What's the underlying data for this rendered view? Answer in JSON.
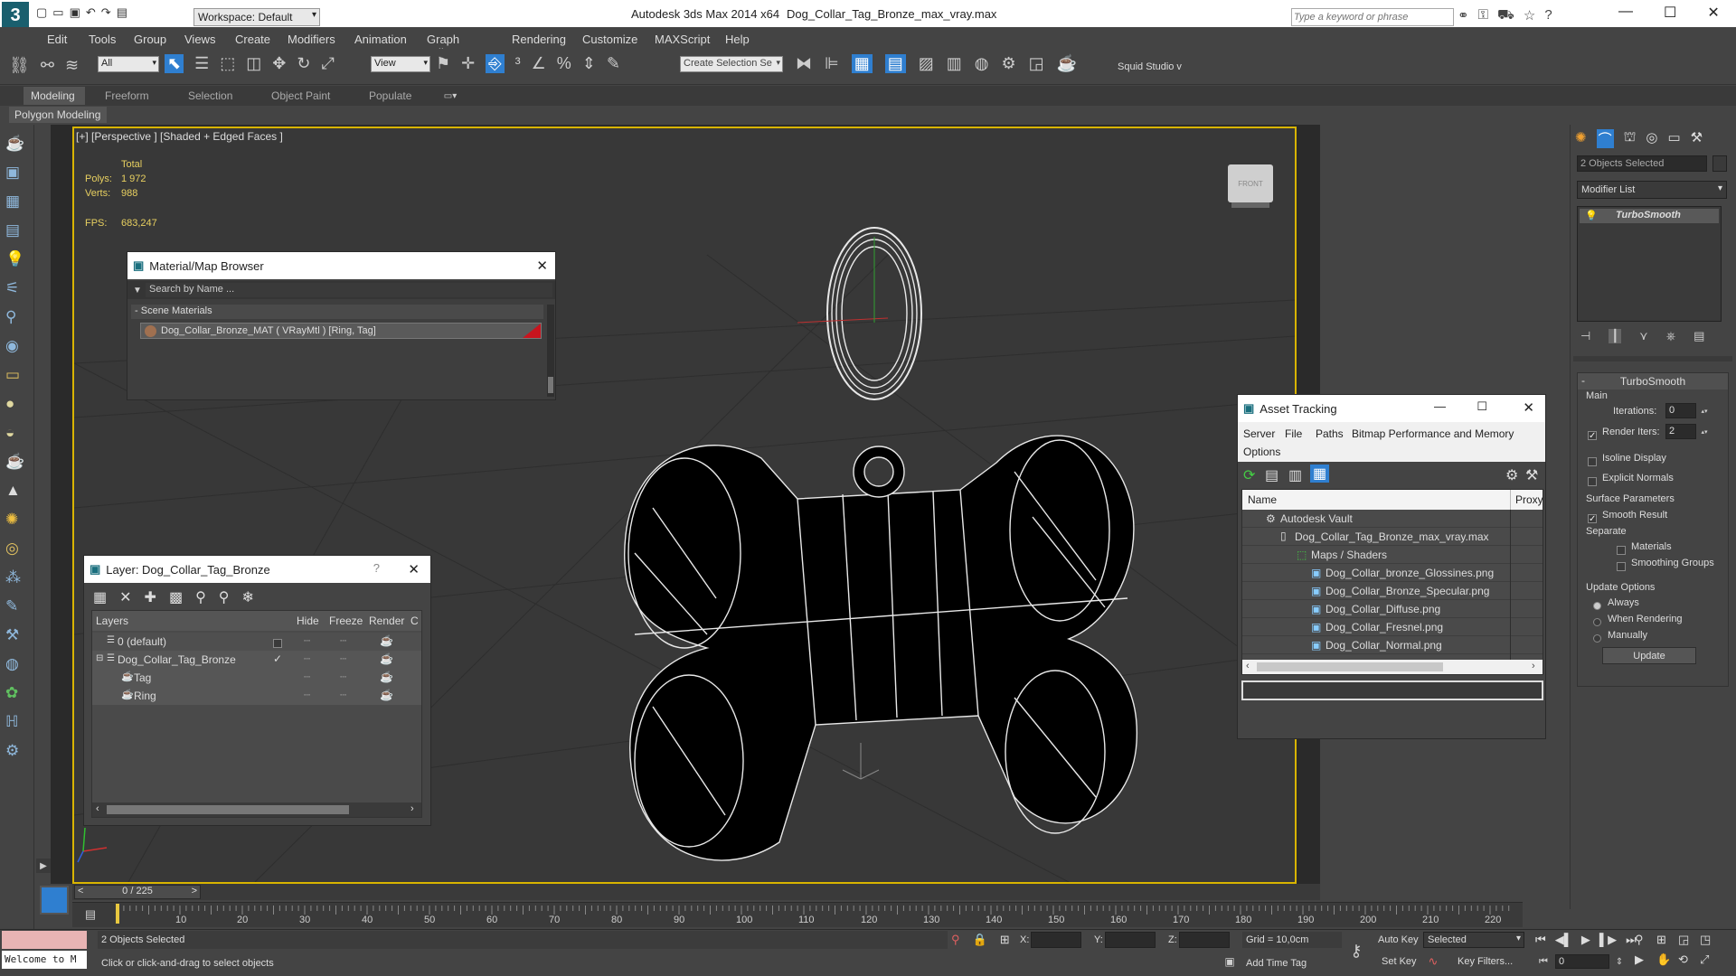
{
  "titlebar": {
    "app": "Autodesk 3ds Max  2014 x64",
    "file": "Dog_Collar_Tag_Bronze_max_vray.max",
    "workspace": "Workspace: Default",
    "search_placeholder": "Type a keyword or phrase"
  },
  "menu": [
    "Edit",
    "Tools",
    "Group",
    "Views",
    "Create",
    "Modifiers",
    "Animation",
    "Graph Editors",
    "Rendering",
    "Customize",
    "MAXScript",
    "Help"
  ],
  "toolbar": {
    "filter": "All",
    "refcoord": "View",
    "selection_set": "Create Selection Se",
    "squid": "Squid Studio v"
  },
  "ribbon": {
    "tabs": [
      "Modeling",
      "Freeform",
      "Selection",
      "Object Paint",
      "Populate"
    ],
    "sub": "Polygon Modeling"
  },
  "viewport": {
    "label": "[+] [Perspective ] [Shaded + Edged Faces ]",
    "stats_total": "Total",
    "polys_label": "Polys:",
    "polys": "1 972",
    "verts_label": "Verts:",
    "verts": "988",
    "fps_label": "FPS:",
    "fps": "683,247",
    "viewcube": "FRONT"
  },
  "material_browser": {
    "title": "Material/Map Browser",
    "search": "Search by Name ...",
    "section": "Scene Materials",
    "item": "Dog_Collar_Bronze_MAT ( VRayMtl ) [Ring, Tag]"
  },
  "layer_dialog": {
    "title": "Layer: Dog_Collar_Tag_Bronze",
    "help": "?",
    "columns": [
      "Layers",
      "Hide",
      "Freeze",
      "Render",
      "C"
    ],
    "rows": [
      "0 (default)",
      "Dog_Collar_Tag_Bronze",
      "Tag",
      "Ring"
    ]
  },
  "asset_tracking": {
    "title": "Asset Tracking",
    "menu": [
      "Server",
      "File",
      "Paths",
      "Bitmap Performance and Memory",
      "Options"
    ],
    "col_name": "Name",
    "col_proxy": "Proxy",
    "rows": [
      "Autodesk Vault",
      "Dog_Collar_Tag_Bronze_max_vray.max",
      "Maps / Shaders",
      "Dog_Collar_bronze_Glossines.png",
      "Dog_Collar_Bronze_Specular.png",
      "Dog_Collar_Diffuse.png",
      "Dog_Collar_Fresnel.png",
      "Dog_Collar_Normal.png"
    ]
  },
  "command_panel": {
    "selection": "2 Objects Selected",
    "modifier_list": "Modifier List",
    "stack_item": "TurboSmooth",
    "rollout": "TurboSmooth",
    "main": "Main",
    "iterations_label": "Iterations:",
    "iterations": "0",
    "render_iters_label": "Render Iters:",
    "render_iters": "2",
    "isoline": "Isoline Display",
    "explicit": "Explicit Normals",
    "surface": "Surface Parameters",
    "smooth_result": "Smooth Result",
    "separate": "Separate",
    "materials": "Materials",
    "smoothing": "Smoothing Groups",
    "update_options": "Update Options",
    "always": "Always",
    "when_rendering": "When Rendering",
    "manually": "Manually",
    "update_btn": "Update"
  },
  "timeline": {
    "frame": "0 / 225",
    "ticks": [
      "10",
      "20",
      "30",
      "40",
      "50",
      "60",
      "70",
      "80",
      "90",
      "100",
      "110",
      "120",
      "130",
      "140",
      "150",
      "160",
      "170",
      "180",
      "190",
      "200",
      "210",
      "220"
    ]
  },
  "status": {
    "selected": "2 Objects Selected",
    "prompt": "Click or click-and-drag to select objects",
    "welcome": "Welcome to M",
    "x": "X:",
    "y": "Y:",
    "z": "Z:",
    "grid": "Grid = 10,0cm",
    "add_time_tag": "Add Time Tag",
    "auto_key": "Auto Key",
    "set_key": "Set Key",
    "key_mode": "Selected",
    "key_filters": "Key Filters...",
    "frame_field": "0"
  },
  "colors": {
    "accent": "#2f7fd0",
    "viewport_border": "#d8b400",
    "mat_swatch": "#c8141e"
  }
}
